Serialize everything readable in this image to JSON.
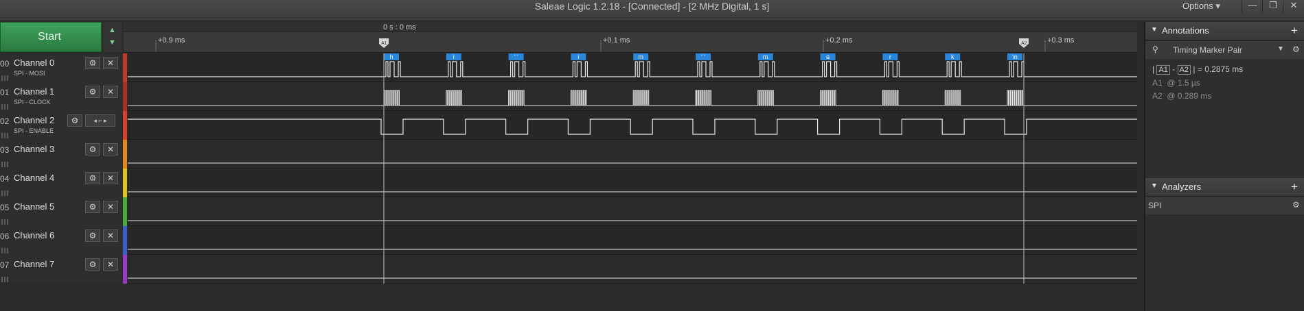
{
  "window": {
    "title": "Saleae Logic 1.2.18 - [Connected] - [2 MHz Digital, 1 s]",
    "options_label": "Options ▾",
    "minimize_icon": "—",
    "restore_icon": "❐",
    "close_icon": "✕"
  },
  "toolbar": {
    "start_label": "Start"
  },
  "timeline": {
    "origin_label": "0 s : 0 ms",
    "ticks": [
      {
        "label": "+0.9 ms"
      },
      {
        "label": "+0.1 ms"
      },
      {
        "label": "+0.2 ms"
      },
      {
        "label": "+0.3 ms"
      }
    ],
    "marker_a1": "A1",
    "marker_a2": "A2"
  },
  "channels": [
    {
      "num": "00",
      "name": "Channel 0",
      "sub": "SPI - MOSI",
      "color": "#c0392b"
    },
    {
      "num": "01",
      "name": "Channel 1",
      "sub": "SPI - CLOCK",
      "color": "#a8322a"
    },
    {
      "num": "02",
      "name": "Channel 2",
      "sub": "SPI - ENABLE",
      "color": "#d6402e"
    },
    {
      "num": "03",
      "name": "Channel 3",
      "sub": "",
      "color": "#e08a1e"
    },
    {
      "num": "04",
      "name": "Channel 4",
      "sub": "",
      "color": "#e0c21e"
    },
    {
      "num": "05",
      "name": "Channel 5",
      "sub": "",
      "color": "#4aa83a"
    },
    {
      "num": "06",
      "name": "Channel 6",
      "sub": "",
      "color": "#3a5fc8"
    },
    {
      "num": "07",
      "name": "Channel 7",
      "sub": "",
      "color": "#9a3ac8"
    }
  ],
  "decoded_bytes": [
    "h",
    "i",
    "' '",
    "i",
    "m",
    "' '",
    "m",
    "a",
    "r",
    "k",
    "\\n"
  ],
  "annotations": {
    "header": "Annotations",
    "timing_pair_label": "Timing Marker Pair",
    "pair_a1": "A1",
    "pair_a2": "A2",
    "pair_value": "= 0.2875 ms",
    "a1_label": "A1",
    "a1_value": "@ 1.5 µs",
    "a2_label": "A2",
    "a2_value": "@ 0.289 ms"
  },
  "analyzers": {
    "header": "Analyzers",
    "items": [
      {
        "label": "SPI"
      }
    ]
  },
  "colors": {
    "accent_green": "#3fa45a",
    "decode_blue": "#2a86d8",
    "signal": "#e8e8e8"
  },
  "icons": {
    "gear": "⚙",
    "close": "✕",
    "plus": "+",
    "collapse": "▼",
    "up": "▲",
    "down": "▼"
  }
}
